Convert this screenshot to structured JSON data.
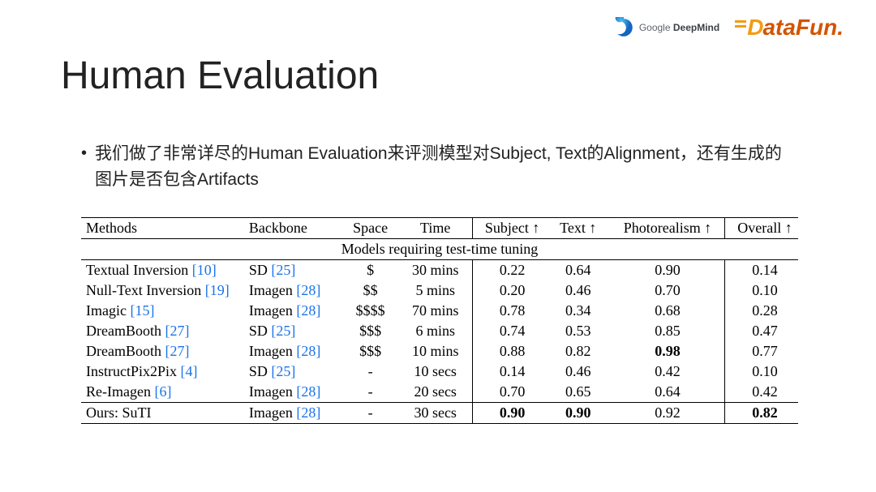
{
  "logos": {
    "deepmind_label": "Google ",
    "deepmind_bold": "DeepMind",
    "datafun_d": "D",
    "datafun_rest": "ataFun."
  },
  "title": "Human Evaluation",
  "bullet": "我们做了非常详尽的Human Evaluation来评测模型对Subject, Text的Alignment，还有生成的图片是否包含Artifacts",
  "table": {
    "headers": {
      "methods": "Methods",
      "backbone": "Backbone",
      "space": "Space",
      "time": "Time",
      "subject": "Subject ↑",
      "text": "Text ↑",
      "photorealism": "Photorealism ↑",
      "overall": "Overall ↑"
    },
    "section_label": "Models requiring test-time tuning",
    "rows": [
      {
        "method": "Textual Inversion",
        "method_ref": "[10]",
        "backbone": "SD",
        "backbone_ref": "[25]",
        "space": "$",
        "time": "30 mins",
        "subject": "0.22",
        "text": "0.64",
        "photo": "0.90",
        "overall": "0.14"
      },
      {
        "method": "Null-Text Inversion",
        "method_ref": "[19]",
        "backbone": "Imagen",
        "backbone_ref": "[28]",
        "space": "$$",
        "time": "5 mins",
        "subject": "0.20",
        "text": "0.46",
        "photo": "0.70",
        "overall": "0.10"
      },
      {
        "method": "Imagic",
        "method_ref": "[15]",
        "backbone": "Imagen",
        "backbone_ref": "[28]",
        "space": "$$$$",
        "time": "70 mins",
        "subject": "0.78",
        "text": "0.34",
        "photo": "0.68",
        "overall": "0.28"
      },
      {
        "method": "DreamBooth",
        "method_ref": "[27]",
        "backbone": "SD",
        "backbone_ref": "[25]",
        "space": "$$$",
        "time": "6 mins",
        "subject": "0.74",
        "text": "0.53",
        "photo": "0.85",
        "overall": "0.47"
      },
      {
        "method": "DreamBooth",
        "method_ref": "[27]",
        "backbone": "Imagen",
        "backbone_ref": "[28]",
        "space": "$$$",
        "time": "10 mins",
        "subject": "0.88",
        "text": "0.82",
        "photo": "0.98",
        "photo_bold": true,
        "overall": "0.77"
      },
      {
        "method": "InstructPix2Pix",
        "method_ref": "[4]",
        "backbone": "SD",
        "backbone_ref": "[25]",
        "space": "-",
        "time": "10 secs",
        "subject": "0.14",
        "text": "0.46",
        "photo": "0.42",
        "overall": "0.10"
      },
      {
        "method": "Re-Imagen",
        "method_ref": "[6]",
        "backbone": "Imagen",
        "backbone_ref": "[28]",
        "space": "-",
        "time": "20 secs",
        "subject": "0.70",
        "text": "0.65",
        "photo": "0.64",
        "overall": "0.42"
      }
    ],
    "ours": {
      "method": "Ours: SuTI",
      "method_ref": "",
      "backbone": "Imagen",
      "backbone_ref": "[28]",
      "space": "-",
      "time": "30 secs",
      "subject": "0.90",
      "subject_bold": true,
      "text": "0.90",
      "text_bold": true,
      "photo": "0.92",
      "overall": "0.82",
      "overall_bold": true
    }
  },
  "chart_data": {
    "type": "table",
    "title": "Human Evaluation",
    "columns": [
      "Methods",
      "Backbone",
      "Space",
      "Time",
      "Subject",
      "Text",
      "Photorealism",
      "Overall"
    ],
    "rows": [
      [
        "Textual Inversion [10]",
        "SD [25]",
        "$",
        "30 mins",
        0.22,
        0.64,
        0.9,
        0.14
      ],
      [
        "Null-Text Inversion [19]",
        "Imagen [28]",
        "$$",
        "5 mins",
        0.2,
        0.46,
        0.7,
        0.1
      ],
      [
        "Imagic [15]",
        "Imagen [28]",
        "$$$$",
        "70 mins",
        0.78,
        0.34,
        0.68,
        0.28
      ],
      [
        "DreamBooth [27]",
        "SD [25]",
        "$$$",
        "6 mins",
        0.74,
        0.53,
        0.85,
        0.47
      ],
      [
        "DreamBooth [27]",
        "Imagen [28]",
        "$$$",
        "10 mins",
        0.88,
        0.82,
        0.98,
        0.77
      ],
      [
        "InstructPix2Pix [4]",
        "SD [25]",
        "-",
        "10 secs",
        0.14,
        0.46,
        0.42,
        0.1
      ],
      [
        "Re-Imagen [6]",
        "Imagen [28]",
        "-",
        "20 secs",
        0.7,
        0.65,
        0.64,
        0.42
      ],
      [
        "Ours: SuTI",
        "Imagen [28]",
        "-",
        "30 secs",
        0.9,
        0.9,
        0.92,
        0.82
      ]
    ]
  }
}
